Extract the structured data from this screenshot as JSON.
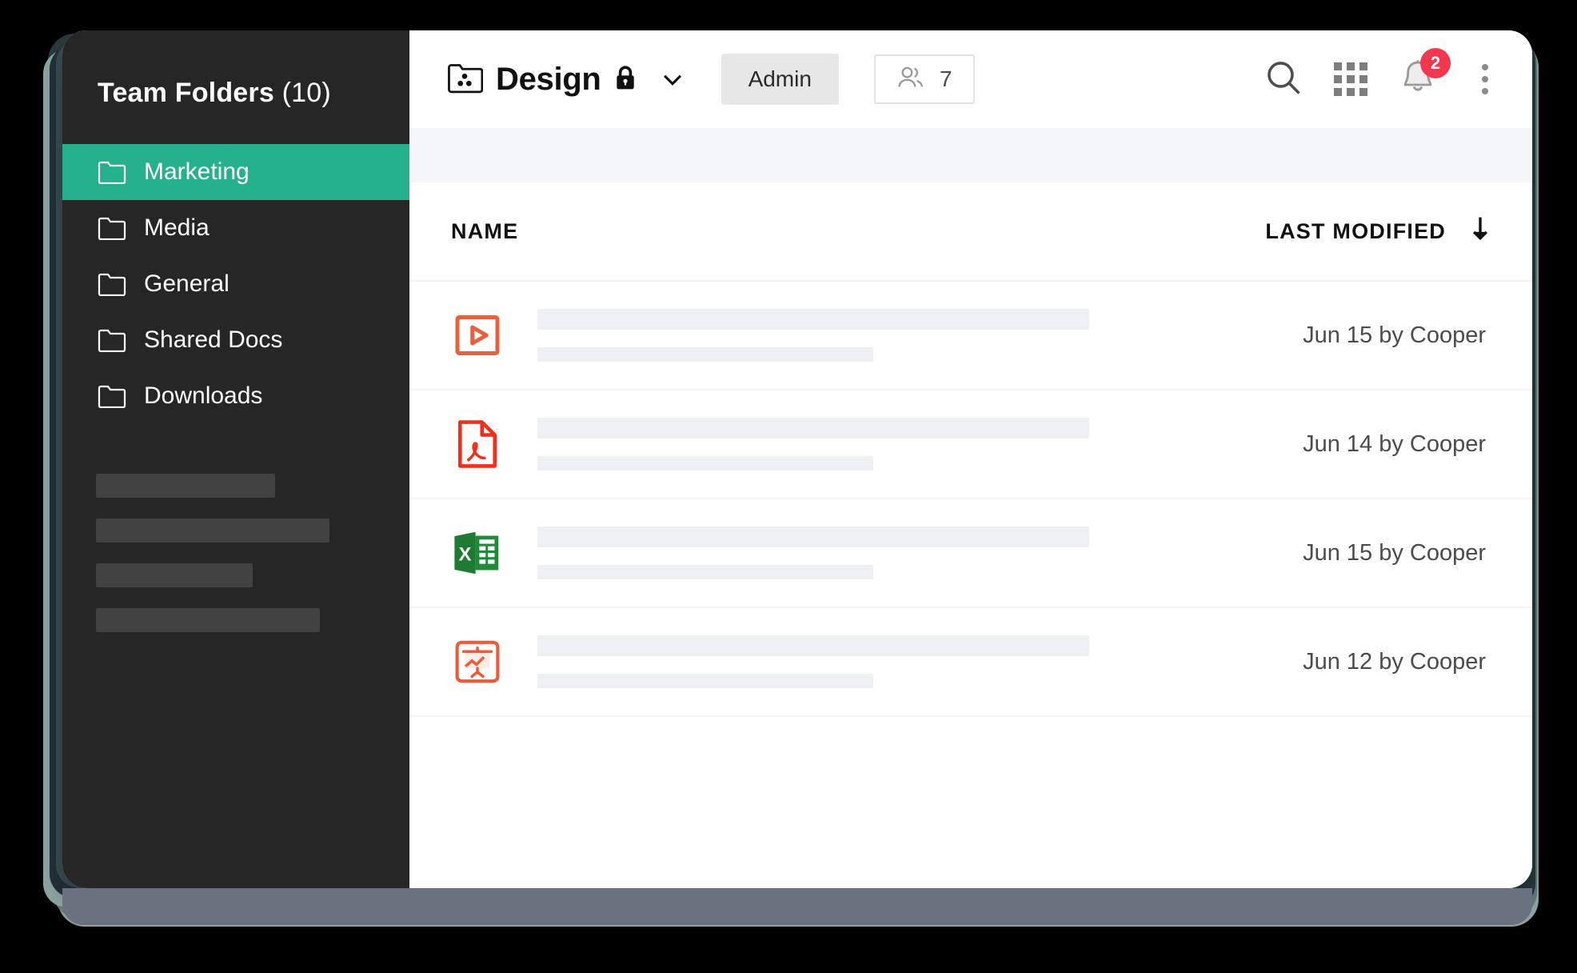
{
  "sidebar": {
    "title_bold": "Team Folders",
    "title_count": "(10)",
    "items": [
      {
        "label": "Marketing",
        "icon": "folder-icon",
        "active": true
      },
      {
        "label": "Media",
        "icon": "folder-icon",
        "active": false
      },
      {
        "label": "General",
        "icon": "folder-icon",
        "active": false
      },
      {
        "label": "Shared Docs",
        "icon": "folder-icon",
        "active": false
      },
      {
        "label": "Downloads",
        "icon": "folder-icon",
        "active": false
      }
    ],
    "placeholder_bar_widths": [
      224,
      292,
      196,
      280
    ]
  },
  "toolbar": {
    "folder_icon": "shared-folder-icon",
    "folder_name": "Design",
    "lock_icon": "lock-icon",
    "dropdown_icon": "chevron-down-icon",
    "role_chip": "Admin",
    "members_icon": "people-icon",
    "members_count": "7",
    "search_icon": "search-icon",
    "apps_icon": "grid-apps-icon",
    "notifications_icon": "bell-icon",
    "notifications_count": "2",
    "overflow_icon": "more-vertical-icon",
    "notification_badge_color": "#f2374f"
  },
  "table": {
    "columns": {
      "name": "NAME",
      "last_modified": "LAST MODIFIED",
      "sort_icon": "arrow-down-icon"
    },
    "rows": [
      {
        "icon": "video-file-icon",
        "icon_color": "#e8603c",
        "name_placeholder_widths": [
          690,
          420
        ],
        "last_modified": "Jun 15 by Cooper"
      },
      {
        "icon": "pdf-file-icon",
        "icon_color": "#f0301c",
        "name_placeholder_widths": [
          690,
          420
        ],
        "last_modified": "Jun 14 by Cooper"
      },
      {
        "icon": "excel-file-icon",
        "icon_color": "#1d7c32",
        "name_placeholder_widths": [
          690,
          420
        ],
        "last_modified": "Jun 15 by Cooper"
      },
      {
        "icon": "presentation-file-icon",
        "icon_color": "#ee5b36",
        "name_placeholder_widths": [
          690,
          420
        ],
        "last_modified": "Jun 12 by Cooper"
      }
    ]
  },
  "theme": {
    "accent": "#25b18c",
    "sidebar_bg": "#262626",
    "chip_bg": "#e7e7e7",
    "placeholder": "#eef1f2",
    "bottom_bar": "#6a717f"
  }
}
